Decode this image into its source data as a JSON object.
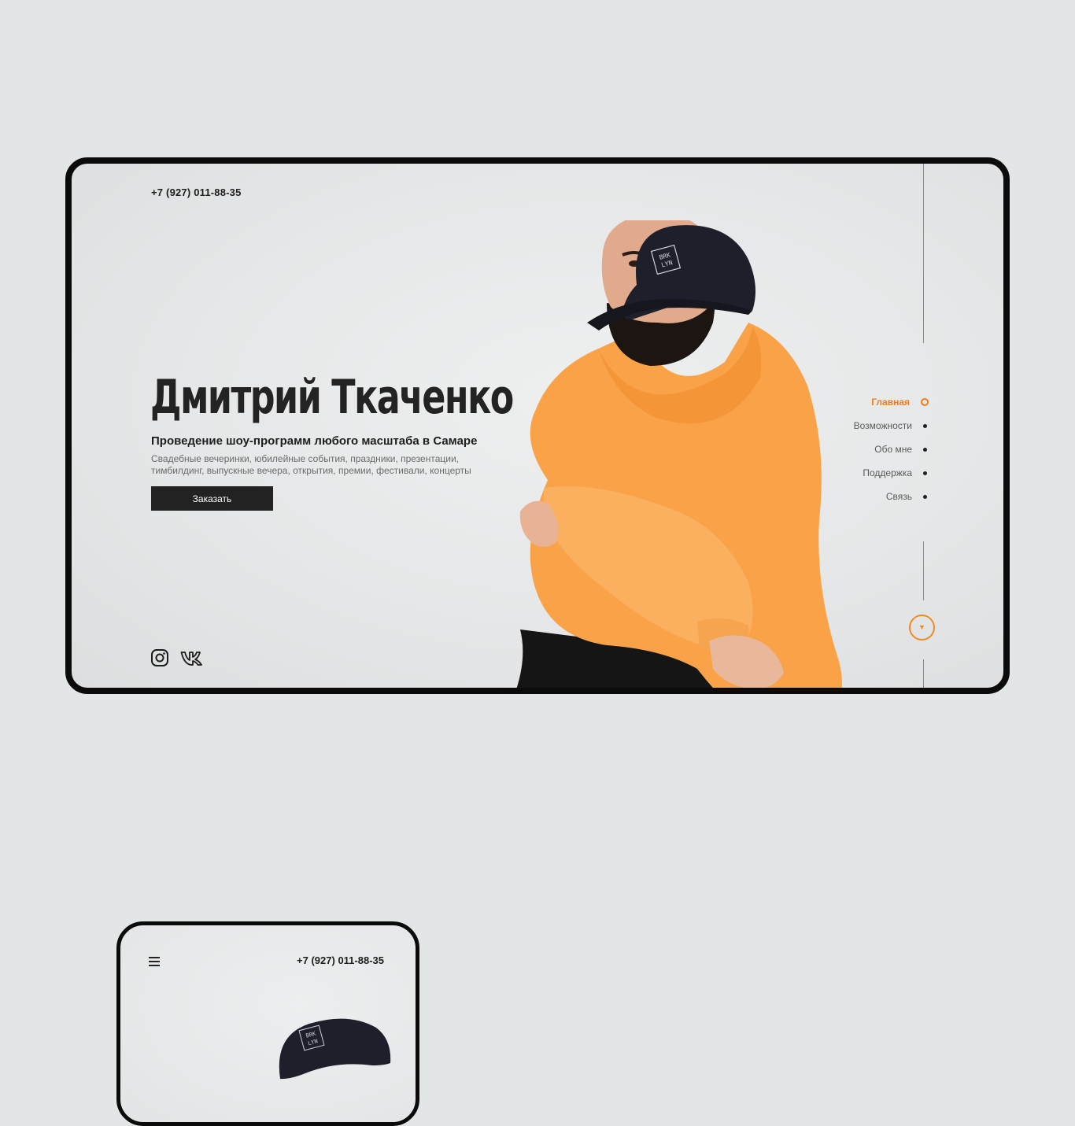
{
  "desktop": {
    "phone": "+7 (927) 011-88-35",
    "name": "Дмитрий Ткаченко",
    "subtitle": "Проведение шоу-программ любого масштаба в Самаре",
    "description": "Свадебные вечеринки, юбилейные события, праздники, презентации, тимбилдинг, выпускные вечера, открытия, премии, фестивали, концерты",
    "cta_label": "Заказать",
    "cap_text_line1": "BRK",
    "cap_text_line2": "LYN",
    "social": [
      "instagram-icon",
      "vk-icon"
    ],
    "nav": [
      {
        "label": "Главная",
        "active": true
      },
      {
        "label": "Возможности",
        "active": false
      },
      {
        "label": "Обо мне",
        "active": false
      },
      {
        "label": "Поддержка",
        "active": false
      },
      {
        "label": "Связь",
        "active": false
      }
    ],
    "scroll_icon": "chevron-down-icon"
  },
  "mobile": {
    "phone": "+7 (927) 011-88-35",
    "menu_icon": "hamburger-icon",
    "cap_text_line1": "BRK",
    "cap_text_line2": "LYN"
  },
  "colors": {
    "accent": "#f07d1a",
    "hoodie": "#f9a248",
    "background": "#e3e6e7",
    "dark": "#222222"
  }
}
